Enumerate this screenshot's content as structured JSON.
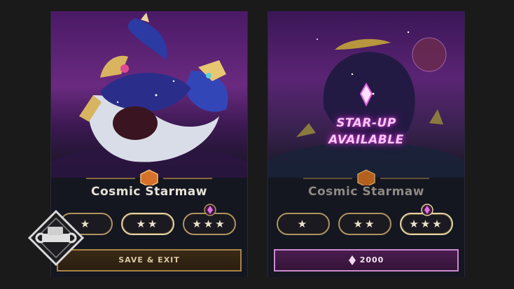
{
  "cards": [
    {
      "title": "Cosmic Starmaw",
      "star_options": [
        "★",
        "★★",
        "★★★"
      ],
      "action_label": "SAVE & EXIT"
    },
    {
      "title": "Cosmic Starmaw",
      "starup_line1": "STAR-UP",
      "starup_line2": "AVAILABLE",
      "star_options": [
        "★",
        "★★",
        "★★★"
      ],
      "price": "2000"
    }
  ],
  "icons": {
    "gem": "gem-icon",
    "logo": "wrench-fist-logo"
  },
  "colors": {
    "gold_border": "#b09460",
    "purple_glow": "#d03ad0"
  }
}
